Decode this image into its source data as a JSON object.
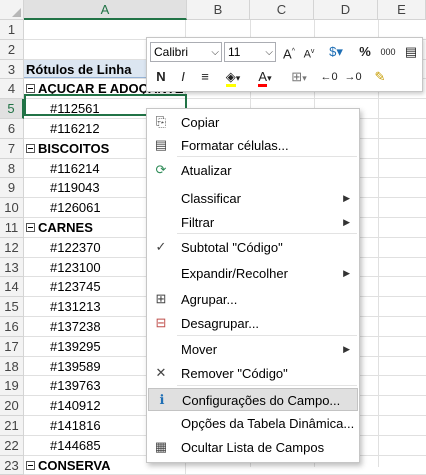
{
  "columns": [
    "A",
    "B",
    "C",
    "D",
    "E"
  ],
  "rows": [
    {
      "n": "1",
      "text": "",
      "type": "empty"
    },
    {
      "n": "2",
      "text": "",
      "type": "empty"
    },
    {
      "n": "3",
      "text": "Rótulos de Linha",
      "type": "header"
    },
    {
      "n": "4",
      "text": "AÇUCAR E ADOÇANTES",
      "type": "group"
    },
    {
      "n": "5",
      "text": "#112561",
      "type": "item"
    },
    {
      "n": "6",
      "text": "#116212",
      "type": "item"
    },
    {
      "n": "7",
      "text": "BISCOITOS",
      "type": "group"
    },
    {
      "n": "8",
      "text": "#116214",
      "type": "item"
    },
    {
      "n": "9",
      "text": "#119043",
      "type": "item"
    },
    {
      "n": "10",
      "text": "#126061",
      "type": "item"
    },
    {
      "n": "11",
      "text": "CARNES",
      "type": "group"
    },
    {
      "n": "12",
      "text": "#122370",
      "type": "item"
    },
    {
      "n": "13",
      "text": "#123100",
      "type": "item"
    },
    {
      "n": "14",
      "text": "#123745",
      "type": "item"
    },
    {
      "n": "15",
      "text": "#131213",
      "type": "item"
    },
    {
      "n": "16",
      "text": "#137238",
      "type": "item"
    },
    {
      "n": "17",
      "text": "#139295",
      "type": "item"
    },
    {
      "n": "18",
      "text": "#139589",
      "type": "item"
    },
    {
      "n": "19",
      "text": "#139763",
      "type": "item"
    },
    {
      "n": "20",
      "text": "#140912",
      "type": "item"
    },
    {
      "n": "21",
      "text": "#141816",
      "type": "item"
    },
    {
      "n": "22",
      "text": "#144685",
      "type": "item"
    },
    {
      "n": "23",
      "text": "CONSERVA",
      "type": "group"
    }
  ],
  "mini_toolbar": {
    "font_name": "Calibri",
    "font_size": "11",
    "grow_font": "A",
    "shrink_font": "A",
    "percent": "%",
    "thousands": "000",
    "bold": "N",
    "italic": "I",
    "font_color": "A"
  },
  "context_menu": [
    {
      "label": "Copiar",
      "icon": "copy-icon",
      "glyph": "⎘",
      "submenu": false
    },
    {
      "label": "Formatar células...",
      "icon": "format-cells-icon",
      "glyph": "▤",
      "submenu": false
    },
    {
      "label": "Atualizar",
      "icon": "refresh-icon",
      "glyph": "⟳",
      "submenu": false
    },
    {
      "label": "Classificar",
      "icon": "",
      "glyph": "",
      "submenu": true
    },
    {
      "label": "Filtrar",
      "icon": "",
      "glyph": "",
      "submenu": true
    },
    {
      "label": "Subtotal \"Código\"",
      "icon": "check-icon",
      "glyph": "✓",
      "submenu": false
    },
    {
      "label": "Expandir/Recolher",
      "icon": "",
      "glyph": "",
      "submenu": true
    },
    {
      "label": "Agrupar...",
      "icon": "group-icon",
      "glyph": "⊞",
      "submenu": false
    },
    {
      "label": "Desagrupar...",
      "icon": "ungroup-icon",
      "glyph": "⊟",
      "submenu": false
    },
    {
      "label": "Mover",
      "icon": "",
      "glyph": "",
      "submenu": true
    },
    {
      "label": "Remover \"Código\"",
      "icon": "remove-icon",
      "glyph": "✕",
      "submenu": false
    },
    {
      "label": "Configurações do Campo...",
      "icon": "field-settings-icon",
      "glyph": "ℹ",
      "submenu": false
    },
    {
      "label": "Opções da Tabela Dinâmica...",
      "icon": "",
      "glyph": "",
      "submenu": false
    },
    {
      "label": "Ocultar Lista de Campos",
      "icon": "field-list-icon",
      "glyph": "▦",
      "submenu": false
    }
  ],
  "colors": {
    "accent": "#217346",
    "header_fill": "#dce6f1"
  }
}
